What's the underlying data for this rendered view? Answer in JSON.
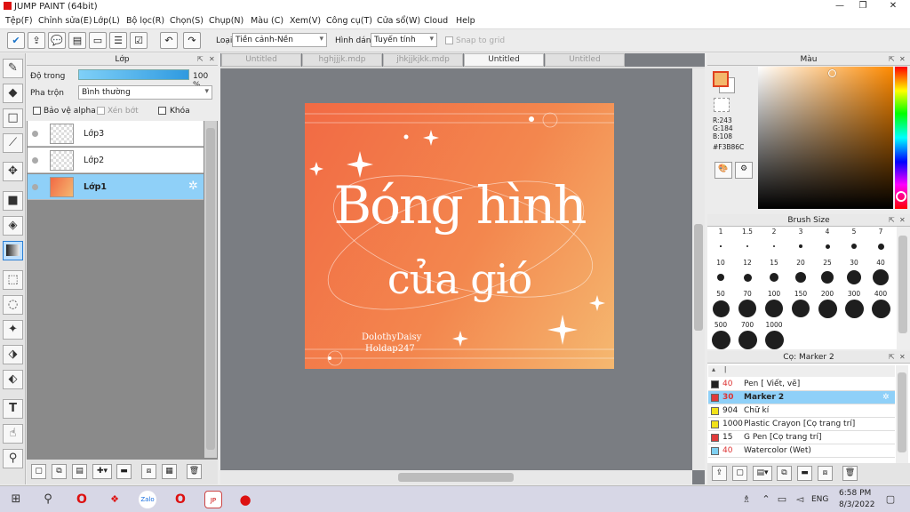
{
  "window": {
    "title": "JUMP PAINT (64bit)",
    "min": "—",
    "max": "❐",
    "close": "✕"
  },
  "menu": [
    "Tệp(F)",
    "Chỉnh sửa(E)",
    "Lớp(L)",
    "Bộ lọc(R)",
    "Chọn(S)",
    "Chụp(N)",
    "Màu (C)",
    "Xem(V)",
    "Công cụ(T)",
    "Cửa sổ(W)",
    "Cloud",
    "Help"
  ],
  "toolbar": {
    "type_label": "Loại",
    "type_value": "Tiền cảnh-Nền",
    "shape_label": "Hình dáng",
    "shape_value": "Tuyến tính",
    "snap_label": "Snap to grid"
  },
  "layer_panel": {
    "title": "Lớp",
    "opacity_label": "Độ trong",
    "opacity_value": "100 %",
    "opacity_fraction": 1.0,
    "blend_label": "Pha trộn",
    "blend_value": "Bình thường",
    "protect_alpha": "Bảo vệ alpha",
    "clip": "Xén bớt",
    "lock": "Khóa",
    "layers": [
      {
        "name": "Lớp3"
      },
      {
        "name": "Lớp2"
      },
      {
        "name": "Lớp1"
      }
    ]
  },
  "tabs": [
    "Untitled",
    "hghjjjk.mdp",
    "jhkjjkjkk.mdp",
    "Untitled",
    "Untitled"
  ],
  "artwork": {
    "line1": "Bóng hình",
    "line2": "của gió",
    "credit1": "DolothyDaisy",
    "credit2": "Holdap247"
  },
  "color_panel": {
    "title": "Màu",
    "r": "R:243",
    "g": "G:184",
    "b": "B:108",
    "hex": "#F3B86C",
    "fg": "#F3B86C",
    "bg": "#ffffff"
  },
  "brush_panel": {
    "title": "Brush Size",
    "sizes": [
      "1",
      "1.5",
      "2",
      "3",
      "4",
      "5",
      "7",
      "10",
      "12",
      "15",
      "20",
      "25",
      "30",
      "40",
      "50",
      "70",
      "100",
      "150",
      "200",
      "300",
      "400",
      "500",
      "700",
      "1000"
    ]
  },
  "tool_panel": {
    "title": "Cọ: Marker 2",
    "tools": [
      {
        "size": "40",
        "name": "Pen [ Viết, vẽ]",
        "color": "#222222"
      },
      {
        "size": "30",
        "name": "Marker 2",
        "color": "#e03a3a"
      },
      {
        "size": "904",
        "name": "Chữ kí",
        "color": "#f2e21a"
      },
      {
        "size": "1000",
        "name": "Plastic Crayon [Cọ trang trí]",
        "color": "#f2e21a"
      },
      {
        "size": "15",
        "name": "G Pen [Cọ trang trí]",
        "color": "#e03a3a"
      },
      {
        "size": "40",
        "name": "Watercolor (Wet)",
        "color": "#7fd0f2"
      }
    ]
  },
  "taskbar": {
    "lang": "ENG",
    "time": "6:58 PM",
    "date": "8/3/2022"
  }
}
